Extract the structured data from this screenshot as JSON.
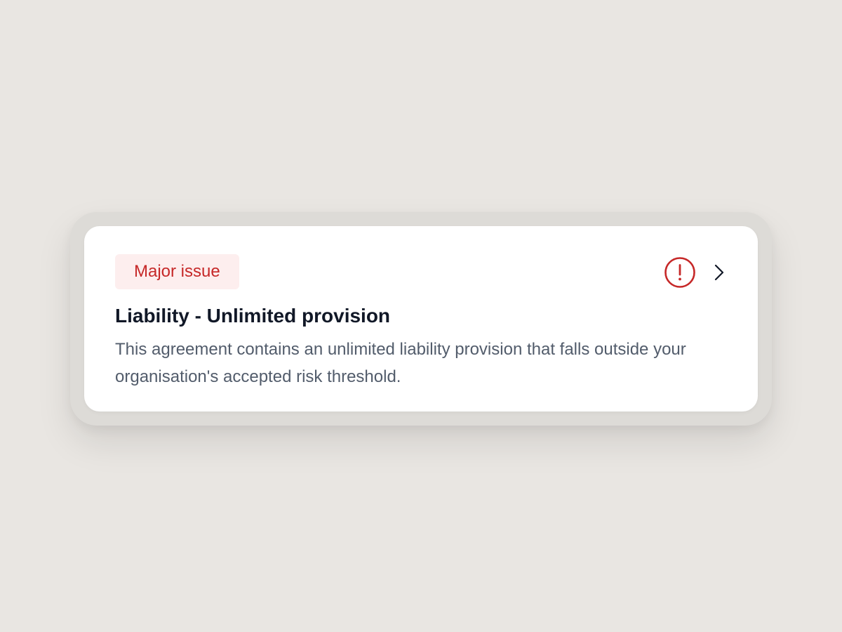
{
  "issue_card": {
    "severity_label": "Major issue",
    "severity_color": "#c62828",
    "severity_bg": "#fdeeee",
    "title": "Liability - Unlimited provision",
    "description": "This agreement contains an unlimited liability provision that falls outside your organisation's accepted risk threshold.",
    "status_icon": "alert-circle-icon",
    "action_icon": "chevron-right-icon"
  }
}
